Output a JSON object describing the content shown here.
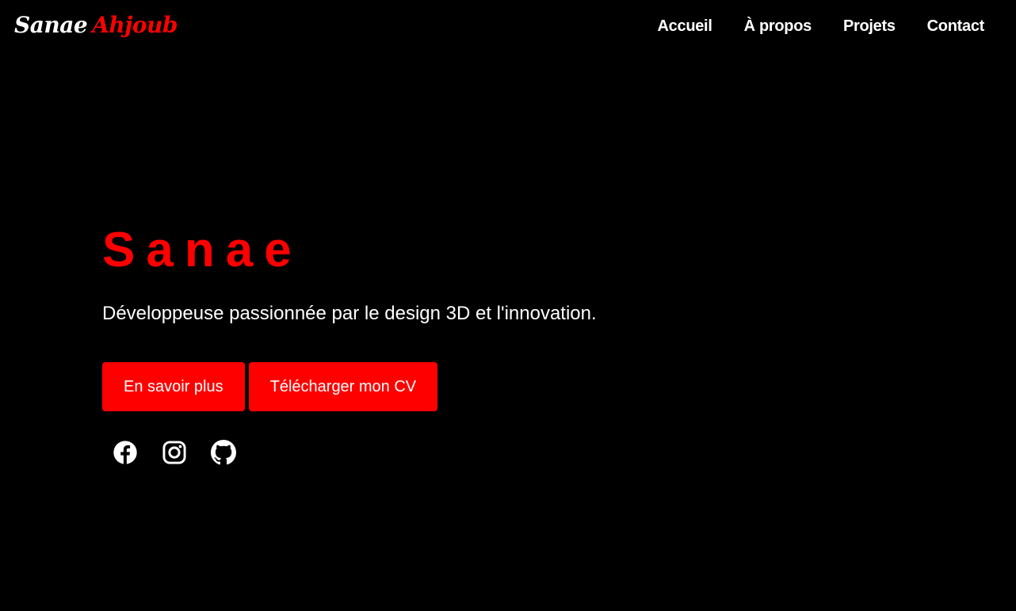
{
  "header": {
    "logo_first": "Sanae",
    "logo_last": "Ahjoub",
    "nav": [
      {
        "label": "Accueil"
      },
      {
        "label": "À propos"
      },
      {
        "label": "Projets"
      },
      {
        "label": "Contact"
      }
    ]
  },
  "hero": {
    "title": "Sanae",
    "subtitle": "Développeuse passionnée par le design 3D et l'innovation.",
    "primary_button": "En savoir plus",
    "secondary_button": "Télécharger mon CV",
    "socials": [
      {
        "icon": "facebook-icon"
      },
      {
        "icon": "instagram-icon"
      },
      {
        "icon": "github-icon"
      }
    ]
  },
  "colors": {
    "background": "#000000",
    "accent": "#ff0000",
    "text": "#ffffff"
  }
}
